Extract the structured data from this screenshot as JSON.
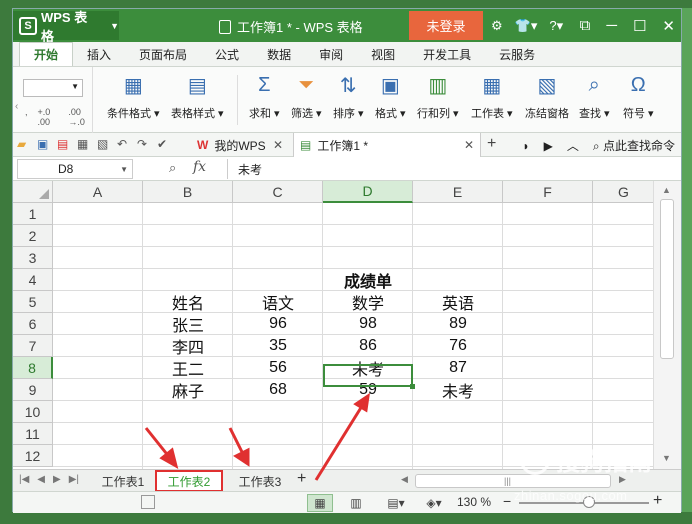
{
  "titlebar": {
    "app_name": "WPS 表格",
    "app_logo": "S",
    "doc_title": "工作簿1 * - WPS 表格",
    "login_label": "未登录",
    "icons": [
      "skin-icon",
      "shirt-icon",
      "help-icon"
    ],
    "window_controls": [
      "restore-icon",
      "minimize-icon",
      "maximize-icon",
      "close-icon"
    ]
  },
  "menu": [
    "开始",
    "插入",
    "页面布局",
    "公式",
    "数据",
    "审阅",
    "视图",
    "开发工具",
    "云服务"
  ],
  "ribbon": {
    "buttons": [
      {
        "label": "条件格式 ▾",
        "icon": "▦"
      },
      {
        "label": "表格样式 ▾",
        "icon": "▤"
      },
      {
        "label": "求和 ▾",
        "icon": "Σ"
      },
      {
        "label": "筛选 ▾",
        "icon": "⏷"
      },
      {
        "label": "排序 ▾",
        "icon": "⇅"
      },
      {
        "label": "格式 ▾",
        "icon": "▣"
      },
      {
        "label": "行和列 ▾",
        "icon": "▥"
      },
      {
        "label": "工作表 ▾",
        "icon": "▦"
      },
      {
        "label": "冻结窗格",
        "icon": "▧"
      },
      {
        "label": "查找 ▾",
        "icon": "⌕"
      },
      {
        "label": "符号 ▾",
        "icon": "Ω"
      }
    ],
    "decimal_inc": "+.0 .00",
    "decimal_dec": ".00 →.0"
  },
  "docbar": {
    "tab1_label": "我的WPS",
    "tab2_label": "工作簿1 *",
    "search_label": "点此查找命令"
  },
  "formula": {
    "name_box": "D8",
    "fx": "fx",
    "value": "未考"
  },
  "sheet": {
    "columns": [
      "A",
      "B",
      "C",
      "D",
      "E",
      "F",
      "G"
    ],
    "rows": [
      "1",
      "2",
      "3",
      "4",
      "5",
      "6",
      "7",
      "8",
      "9",
      "10",
      "11",
      "12"
    ],
    "title": "成绩单",
    "headers": [
      "姓名",
      "语文",
      "数学",
      "英语"
    ],
    "data": [
      [
        "张三",
        "96",
        "98",
        "89"
      ],
      [
        "李四",
        "35",
        "86",
        "76"
      ],
      [
        "王二",
        "56",
        "未考",
        "87"
      ],
      [
        "麻子",
        "68",
        "59",
        "未考"
      ]
    ]
  },
  "sheet_tabs": [
    "工作表1",
    "工作表2",
    "工作表3"
  ],
  "status": {
    "zoom": "130 %"
  },
  "watermark": {
    "brand": "搜狗指南",
    "url": "zhinan.sogou.com"
  },
  "colors": {
    "accent": "#3c8d3c",
    "login": "#e8663d",
    "annotation": "#e03030"
  }
}
